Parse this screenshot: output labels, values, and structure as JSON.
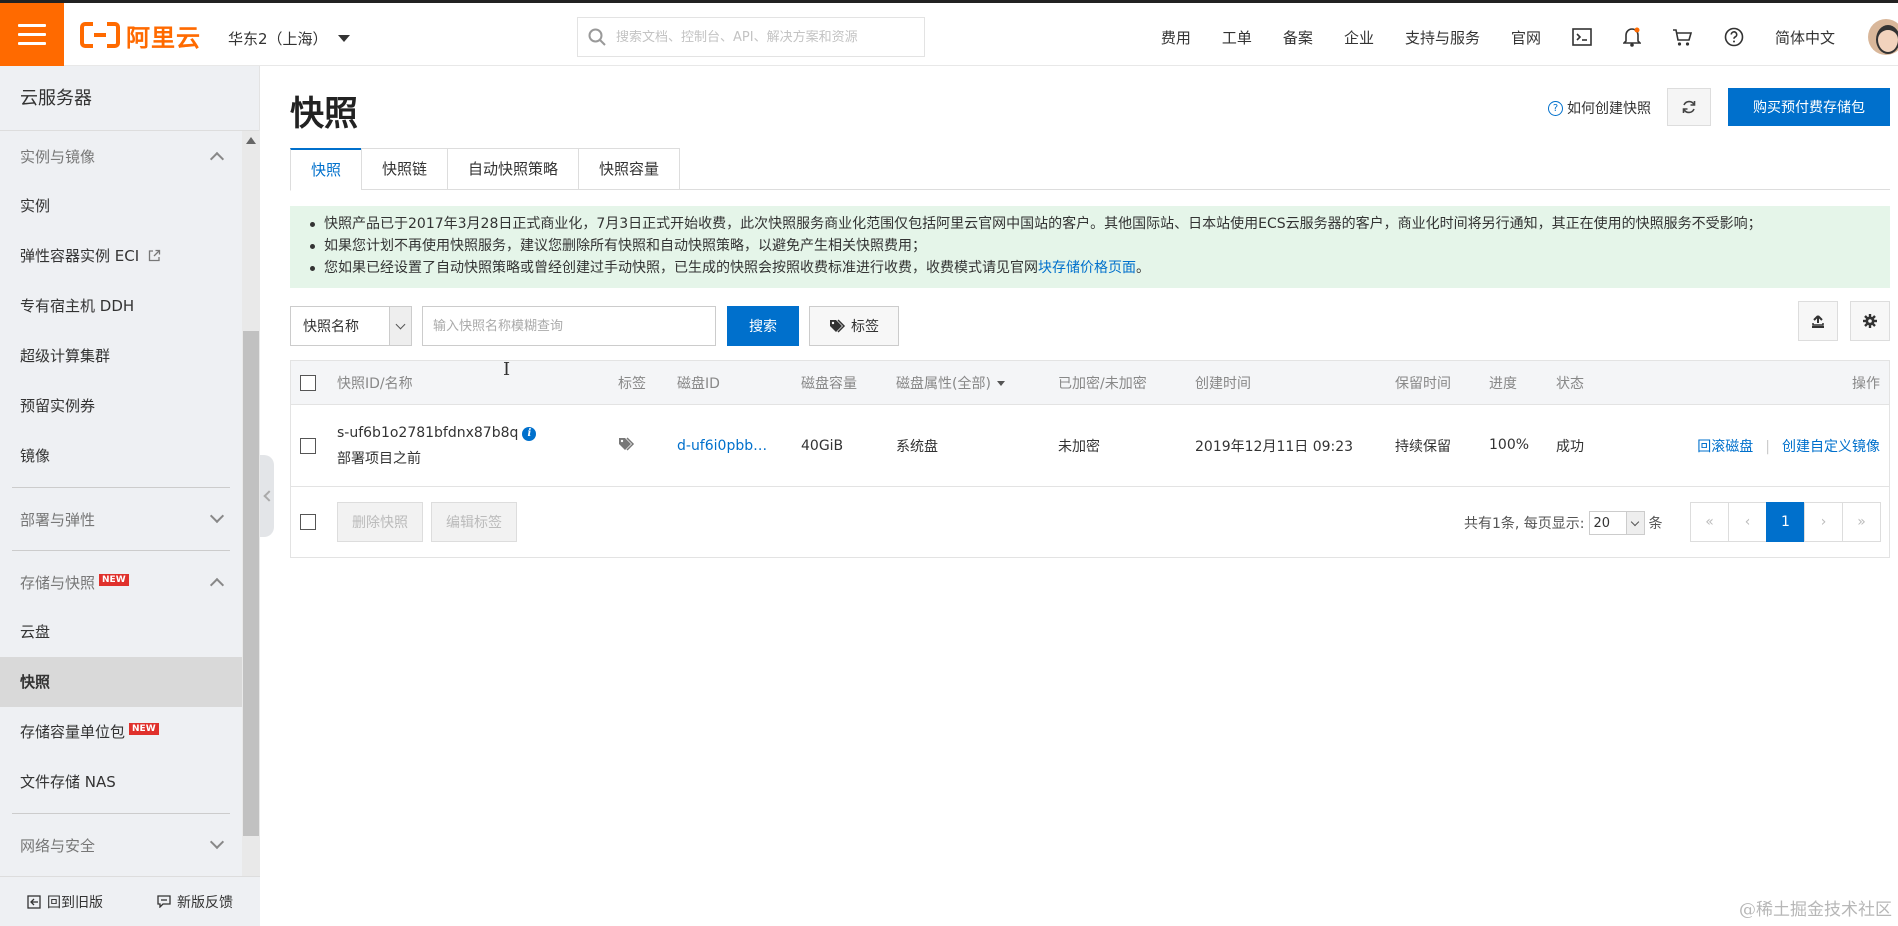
{
  "topbar": {
    "logo_text": "阿里云",
    "region": "华东2（上海）",
    "search_placeholder": "搜索文档、控制台、API、解决方案和资源",
    "nav": [
      "费用",
      "工单",
      "备案",
      "企业",
      "支持与服务",
      "官网"
    ],
    "icons": [
      "terminal-icon",
      "bell-icon",
      "cart-icon",
      "help-icon"
    ],
    "language": "简体中文"
  },
  "sidebar": {
    "title": "云服务器",
    "group_instances": "实例与镜像",
    "items_instances": [
      "实例",
      "弹性容器实例 ECI",
      "专有宿主机 DDH",
      "超级计算集群",
      "预留实例券",
      "镜像"
    ],
    "group_deploy": "部署与弹性",
    "group_storage": "存储与快照",
    "badge": "NEW",
    "items_storage": [
      "云盘",
      "快照",
      "存储容量单位包",
      "文件存储 NAS"
    ],
    "group_network": "网络与安全",
    "footer_back": "回到旧版",
    "footer_feedback": "新版反馈"
  },
  "page": {
    "title": "快照",
    "help_link": "如何创建快照",
    "buy_button": "购买预付费存储包",
    "tabs": [
      "快照",
      "快照链",
      "自动快照策略",
      "快照容量"
    ],
    "notice": {
      "line1": "快照产品已于2017年3月28日正式商业化，7月3日正式开始收费，此次快照服务商业化范围仅包括阿里云官网中国站的客户。其他国际站、日本站使用ECS云服务器的客户，商业化时间将另行通知，其正在使用的快照服务不受影响；",
      "line2": "如果您计划不再使用快照服务，建议您删除所有快照和自动快照策略，以避免产生相关快照费用；",
      "line3_pre": "您如果已经设置了自动快照策略或曾经创建过手动快照，已生成的快照会按照收费标准进行收费，收费模式请见官网",
      "line3_link": "块存储价格页面",
      "line3_post": "。"
    },
    "filter": {
      "select": "快照名称",
      "placeholder": "输入快照名称模糊查询",
      "search": "搜索",
      "tag": "标签"
    },
    "table": {
      "headers": [
        "快照ID/名称",
        "标签",
        "磁盘ID",
        "磁盘容量",
        "磁盘属性(全部)",
        "已加密/未加密",
        "创建时间",
        "保留时间",
        "进度",
        "状态",
        "操作"
      ],
      "row": {
        "id": "s-uf6b1o2781bfdnx87b8q",
        "name": "部署项目之前",
        "disk_id": "d-uf6i0pbb…",
        "capacity": "40GiB",
        "attribute": "系统盘",
        "encryption": "未加密",
        "created": "2019年12月11日 09:23",
        "retention": "持续保留",
        "progress": "100%",
        "status": "成功",
        "action1": "回滚磁盘",
        "action2": "创建自定义镜像"
      }
    },
    "footer": {
      "delete": "删除快照",
      "edit_tags": "编辑标签",
      "total_pre": "共有1条, 每页显示:",
      "page_size": "20",
      "total_post": "条",
      "pages": [
        "«",
        "‹",
        "1",
        "›",
        "»"
      ]
    }
  },
  "watermark": "@稀土掘金技术社区",
  "colors": {
    "brand": "#ff6a00",
    "primary": "#0070cc",
    "notice_bg": "#e5f5e9"
  }
}
